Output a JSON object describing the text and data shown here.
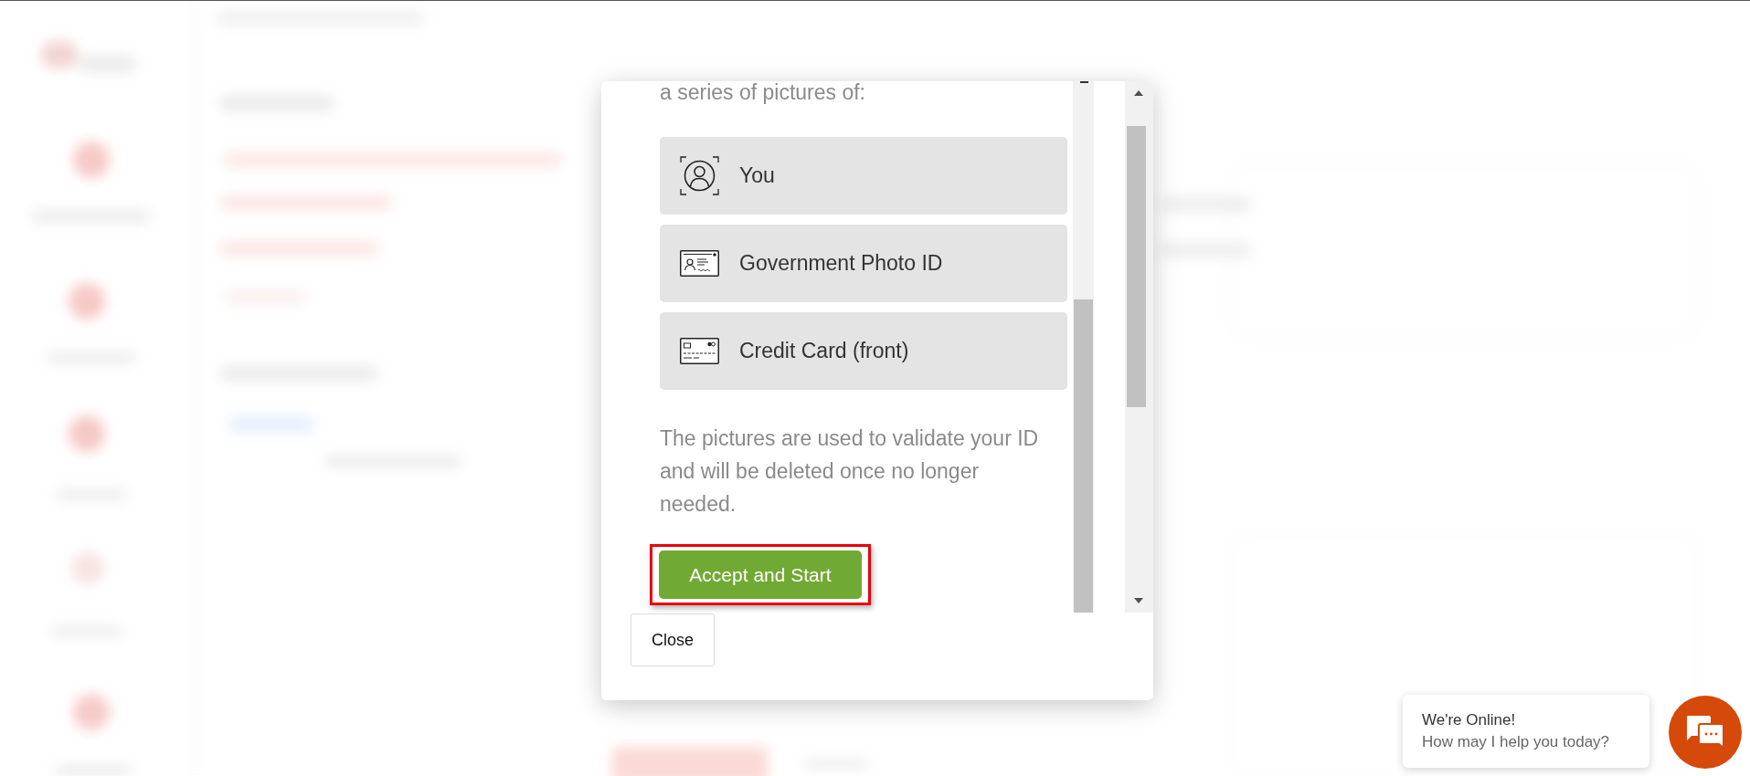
{
  "dialog": {
    "intro_text": "a series of pictures of:",
    "items": [
      {
        "kind": "selfie",
        "label": "You"
      },
      {
        "kind": "id_card",
        "label": "Government Photo ID"
      },
      {
        "kind": "credit_card",
        "label": "Credit Card (front)"
      }
    ],
    "note": "The pictures are used to validate your ID and will be deleted once no longer needed.",
    "accept_button": {
      "label": "Accept and Start",
      "highlighted": true
    },
    "close_button": {
      "label": "Close"
    }
  },
  "chat_widget": {
    "title": "We're Online!",
    "message": "How may I help you today?"
  }
}
